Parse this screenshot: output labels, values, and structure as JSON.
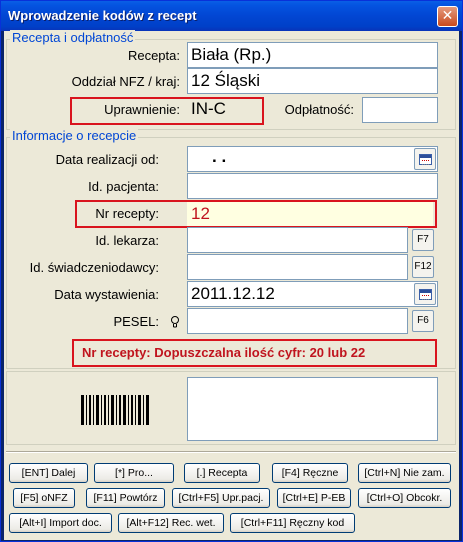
{
  "window": {
    "title": "Wprowadzenie kodów z recept",
    "close_label": "✕"
  },
  "section1": {
    "title": "Recepta i odpłatność",
    "recepta_label": "Recepta:",
    "recepta_value": "Biała (Rp.)",
    "oddzial_label": "Oddział NFZ / kraj:",
    "oddzial_value": "12 Śląski",
    "uprawnienie_label": "Uprawnienie:",
    "uprawnienie_value": "IN-C",
    "odplatnosc_label": "Odpłatność:",
    "odplatnosc_value": ""
  },
  "section2": {
    "title": "Informacje o recepcie",
    "data_realizacji_label": "Data realizacji od:",
    "data_realizacji_value": ". .",
    "id_pacjenta_label": "Id. pacjenta:",
    "id_pacjenta_value": "",
    "nr_recepty_label": "Nr recepty:",
    "nr_recepty_value": "12",
    "id_lekarza_label": "Id. lekarza:",
    "id_lekarza_value": "",
    "id_swiadczeniodawcy_label": "Id. świadczeniodawcy:",
    "id_swiadczeniodawcy_value": "",
    "data_wystawienia_label": "Data wystawienia:",
    "data_wystawienia_value": "2011.12.12",
    "pesel_label": "PESEL:",
    "pesel_value": "",
    "f7_label": "F7",
    "f12_label": "F12",
    "f6_label": "F6",
    "error_message": "Nr recepty: Dopuszczalna ilość cyfr: 20 lub 22"
  },
  "icons": {
    "calendar": "calendar-icon",
    "bulb": "lightbulb-icon",
    "barcode": "barcode-icon"
  },
  "buttons_row1": [
    "[ENT] Dalej",
    "[*] Pro...",
    "[.] Recepta",
    "[F4] Ręczne",
    "[Ctrl+N] Nie zam."
  ],
  "buttons_row2": [
    "[F5] oNFZ",
    "[F11] Powtórz",
    "[Ctrl+F5] Upr.pacj.",
    "[Ctrl+E] P-EB",
    "[Ctrl+O] Obcokr."
  ],
  "buttons_row3": [
    "[Alt+I] Import doc.",
    "[Alt+F12] Rec. wet.",
    "[Ctrl+F11] Ręczny kod"
  ],
  "colors": {
    "accent": "#0046D5",
    "error": "#C0141E",
    "highlight_field": "#FFFFE1",
    "title_bar": "#0246D3"
  }
}
